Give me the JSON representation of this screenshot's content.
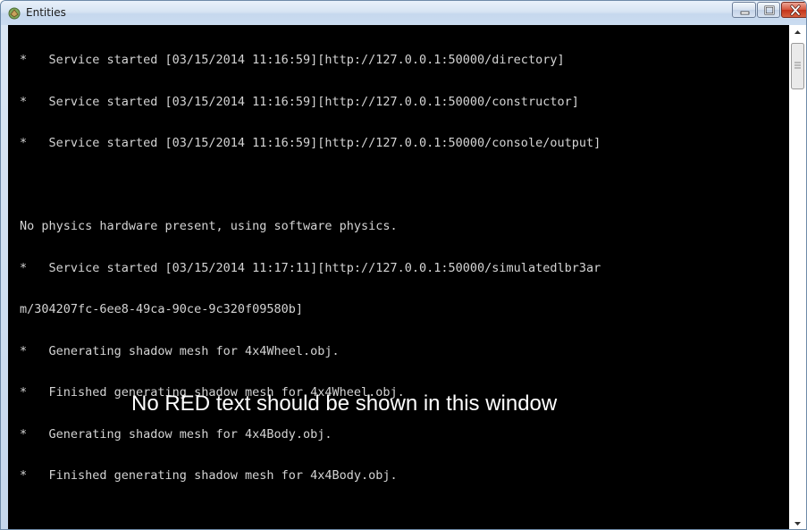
{
  "window": {
    "title": "Entities",
    "icon": "entities-app-icon"
  },
  "console": {
    "lines": [
      "*   Service started [03/15/2014 11:16:59][http://127.0.0.1:50000/directory]",
      "*   Service started [03/15/2014 11:16:59][http://127.0.0.1:50000/constructor]",
      "*   Service started [03/15/2014 11:16:59][http://127.0.0.1:50000/console/output]",
      "",
      "No physics hardware present, using software physics.",
      "*   Service started [03/15/2014 11:17:11][http://127.0.0.1:50000/simulatedlbr3ar",
      "m/304207fc-6ee8-49ca-90ce-9c320f09580b]",
      "*   Generating shadow mesh for 4x4Wheel.obj.",
      "*   Finished generating shadow mesh for 4x4Wheel.obj.",
      "*   Generating shadow mesh for 4x4Body.obj.",
      "*   Finished generating shadow mesh for 4x4Body.obj."
    ],
    "notice": "No RED text should be shown in this window"
  },
  "colors": {
    "console_bg": "#000000",
    "console_fg": "#d4d4d4",
    "notice_fg": "#ffffff",
    "close_button": "#c7432b"
  }
}
